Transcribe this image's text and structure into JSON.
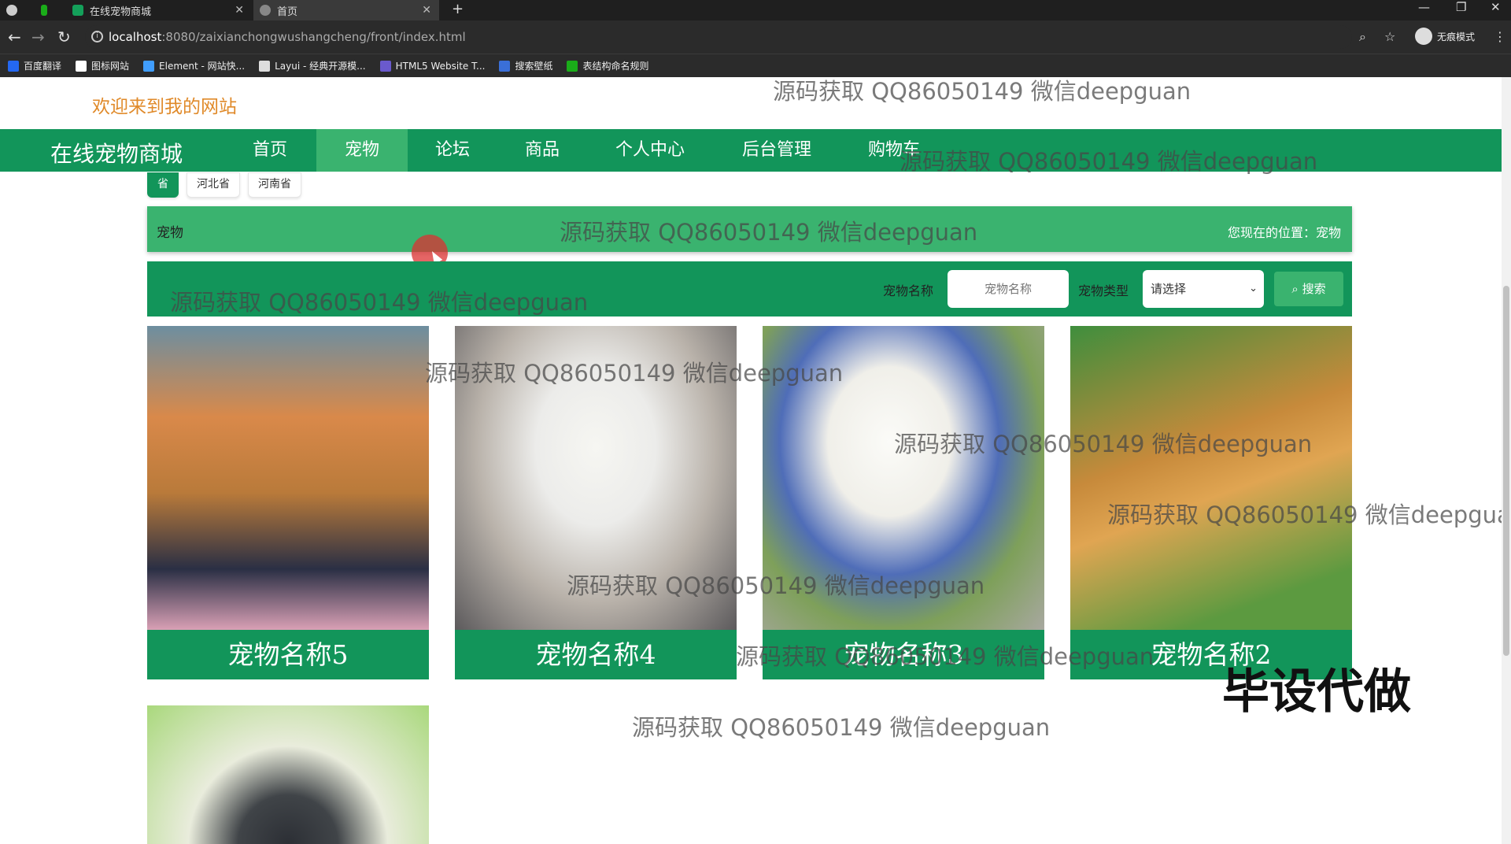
{
  "browser": {
    "tabs": [
      {
        "label": "在线宠物商城",
        "color": "#14a05a"
      },
      {
        "label": "首页",
        "color": "#888888"
      }
    ],
    "new_tab": "+",
    "url_host": "localhost",
    "url_path": ":8080/zaixianchongwushangcheng/front/index.html",
    "incognito_label": "无痕模式",
    "bookmarks": [
      {
        "label": "百度翻译",
        "color": "#2468f2"
      },
      {
        "label": "图标网站",
        "color": "#ffffff"
      },
      {
        "label": "Element - 网站快...",
        "color": "#409eff"
      },
      {
        "label": "Layui - 经典开源模...",
        "color": "#dddddd"
      },
      {
        "label": "HTML5 Website T...",
        "color": "#6a5acd"
      },
      {
        "label": "搜索壁纸",
        "color": "#3a6fd8"
      },
      {
        "label": "表结构命名规则",
        "color": "#1aad19"
      }
    ]
  },
  "header": {
    "welcome": "欢迎来到我的网站",
    "brand": "在线宠物商城",
    "nav": [
      "首页",
      "宠物",
      "论坛",
      "商品",
      "个人中心",
      "后台管理",
      "购物车"
    ],
    "active_nav": "宠物"
  },
  "filters": {
    "provinces": [
      "省",
      "河北省",
      "河南省"
    ]
  },
  "breadcrumb": {
    "title": "宠物",
    "position": "您现在的位置：宠物"
  },
  "search": {
    "name_label": "宠物名称",
    "name_placeholder": "宠物名称",
    "type_label": "宠物类型",
    "type_selected": "请选择",
    "button_label": "搜索"
  },
  "pets": [
    {
      "name": "宠物名称5"
    },
    {
      "name": "宠物名称4"
    },
    {
      "name": "宠物名称3"
    },
    {
      "name": "宠物名称2"
    },
    {
      "name": ""
    }
  ],
  "overlay": {
    "watermark": "源码获取 QQ86050149 微信deepguan",
    "badge": "毕设代做"
  },
  "colors": {
    "primary_green": "#12955a",
    "light_green": "#3ab36f",
    "welcome_orange": "#e08a2a"
  }
}
